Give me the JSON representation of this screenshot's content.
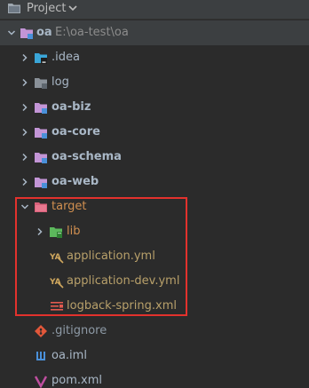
{
  "header": {
    "title": "Project",
    "project_icon": "project-folder-icon",
    "dropdown_icon": "chevron-down-icon"
  },
  "tree": {
    "root": {
      "name": "oa",
      "path": "E:\\oa-test\\oa",
      "icon": "module-folder-icon"
    },
    "items": [
      {
        "name": ".idea",
        "icon": "idea-folder-icon"
      },
      {
        "name": "log",
        "icon": "folder-icon"
      },
      {
        "name": "oa-biz",
        "icon": "module-folder-icon"
      },
      {
        "name": "oa-core",
        "icon": "module-folder-icon"
      },
      {
        "name": "oa-schema",
        "icon": "module-folder-icon"
      },
      {
        "name": "oa-web",
        "icon": "module-folder-icon"
      },
      {
        "name": "target",
        "icon": "excluded-folder-icon"
      },
      {
        "name": "lib",
        "icon": "library-folder-icon"
      },
      {
        "name": "application.yml",
        "icon": "yaml-file-icon"
      },
      {
        "name": "application-dev.yml",
        "icon": "yaml-file-icon"
      },
      {
        "name": "logback-spring.xml",
        "icon": "xml-config-file-icon"
      },
      {
        "name": ".gitignore",
        "icon": "git-file-icon"
      },
      {
        "name": "oa.iml",
        "icon": "iml-file-icon"
      },
      {
        "name": "pom.xml",
        "icon": "maven-pom-icon"
      }
    ]
  },
  "colors": {
    "background": "#2b2b2b",
    "header": "#3c3f41",
    "text": "#a9b7c6",
    "excluded_text": "#d08f50",
    "highlight_border": "#e3322d",
    "module_folder": "#c395d6"
  }
}
